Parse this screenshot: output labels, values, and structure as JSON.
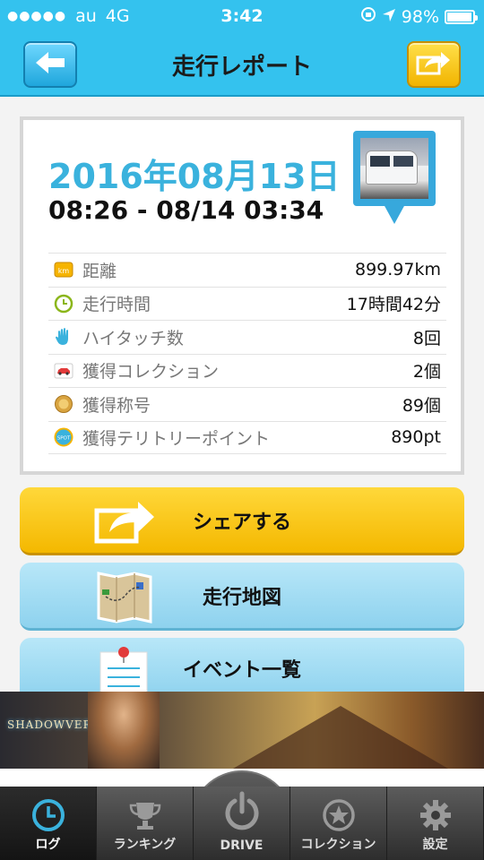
{
  "status_bar": {
    "signal_dots": "●●●●●",
    "carrier": "au",
    "network": "4G",
    "time": "3:42",
    "battery": "98%",
    "battery_level": 0.98
  },
  "header": {
    "title": "走行レポート",
    "back_icon": "arrow-left-icon",
    "share_icon": "share-arrow-icon",
    "color": "#34c2ee"
  },
  "report": {
    "date": "2016年08月13日",
    "time_range": "08:26 - 08/14 03:34",
    "stats": [
      {
        "icon": "km-icon",
        "label": "距離",
        "value": "899.97km"
      },
      {
        "icon": "clock-icon",
        "label": "走行時間",
        "value": "17時間42分"
      },
      {
        "icon": "hand-icon",
        "label": "ハイタッチ数",
        "value": "8回"
      },
      {
        "icon": "car-icon",
        "label": "獲得コレクション",
        "value": "2個"
      },
      {
        "icon": "medal-icon",
        "label": "獲得称号",
        "value": "89個"
      },
      {
        "icon": "spot-icon",
        "label": "獲得テリトリーポイント",
        "value": "890pt"
      }
    ],
    "icon_texts": {
      "km": "km",
      "spot": "SPOT"
    }
  },
  "actions": {
    "share": "シェアする",
    "map": "走行地図",
    "events": "イベント一覧"
  },
  "ad": {
    "logo": "SHADOWVERSE"
  },
  "tabs": [
    {
      "label": "ログ",
      "icon": "clock-icon",
      "active": true
    },
    {
      "label": "ランキング",
      "icon": "trophy-icon",
      "active": false
    },
    {
      "label": "DRIVE",
      "icon": "power-icon",
      "active": false
    },
    {
      "label": "コレクション",
      "icon": "star-icon",
      "active": false
    },
    {
      "label": "設定",
      "icon": "gear-icon",
      "active": false
    }
  ]
}
